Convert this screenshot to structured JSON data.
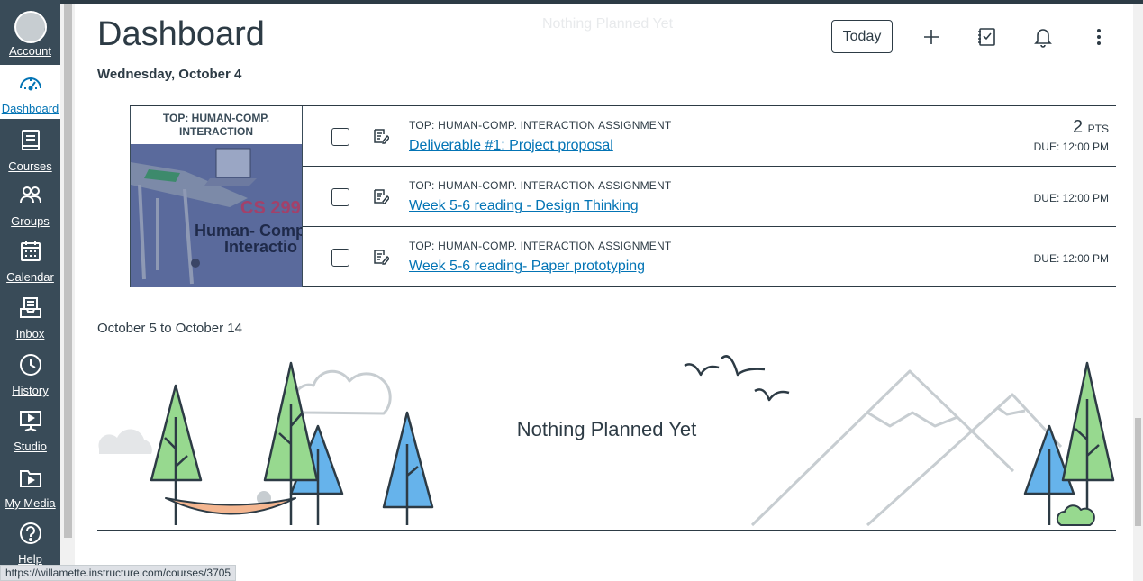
{
  "global_nav": {
    "items": [
      {
        "label": "Account",
        "icon": "account-avatar"
      },
      {
        "label": "Dashboard",
        "icon": "dashboard-icon"
      },
      {
        "label": "Courses",
        "icon": "courses-icon"
      },
      {
        "label": "Groups",
        "icon": "groups-icon"
      },
      {
        "label": "Calendar",
        "icon": "calendar-icon"
      },
      {
        "label": "Inbox",
        "icon": "inbox-icon"
      },
      {
        "label": "History",
        "icon": "history-icon"
      },
      {
        "label": "Studio",
        "icon": "studio-icon"
      },
      {
        "label": "My Media",
        "icon": "my-media-icon"
      },
      {
        "label": "Help",
        "icon": "help-icon"
      }
    ],
    "active": "Dashboard"
  },
  "header": {
    "title": "Dashboard",
    "today_label": "Today",
    "ghost_text": "Nothing Planned Yet"
  },
  "planner": {
    "day_heading": "Wednesday, October 4",
    "course": {
      "name": "TOP: HUMAN-COMP. INTERACTION",
      "image_text_1": "CS 299",
      "image_text_2": "Human- Comp",
      "image_text_3": "Interactio",
      "color": "#4e5f93"
    },
    "items": [
      {
        "type": "TOP: HUMAN-COMP. INTERACTION ASSIGNMENT",
        "title": "Deliverable #1: Project proposal",
        "points": "2",
        "points_unit": "PTS",
        "due": "DUE: 12:00 PM"
      },
      {
        "type": "TOP: HUMAN-COMP. INTERACTION ASSIGNMENT",
        "title": "Week 5-6 reading - Design Thinking",
        "due": "DUE: 12:00 PM"
      },
      {
        "type": "TOP: HUMAN-COMP. INTERACTION ASSIGNMENT",
        "title": "Week 5-6 reading- Paper prototyping",
        "due": "DUE: 12:00 PM"
      }
    ],
    "range_heading": "October 5 to October 14",
    "empty_message": "Nothing Planned Yet"
  },
  "status_bar": {
    "url": "https://willamette.instructure.com/courses/3705"
  },
  "colors": {
    "nav_bg": "#394b58",
    "link": "#0374b5",
    "text": "#2d3b45"
  }
}
